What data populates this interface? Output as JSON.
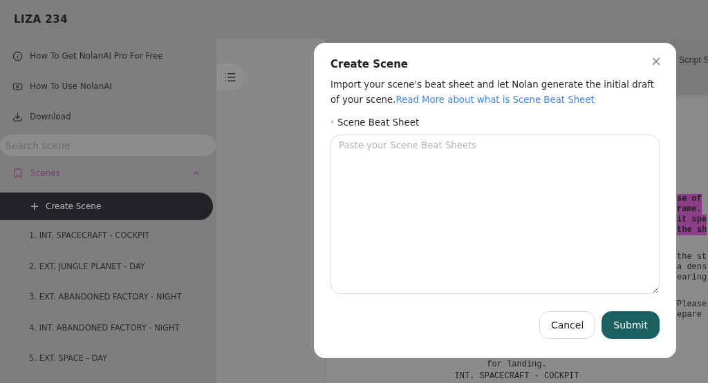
{
  "app": {
    "title": "LIZA 234"
  },
  "sidebar": {
    "links": [
      {
        "kind": "info",
        "label": "How To Get NolanAI Pro For Free"
      },
      {
        "kind": "video",
        "label": "How To Use NolanAI"
      },
      {
        "kind": "download",
        "label": "Download"
      }
    ],
    "search": {
      "placeholder": "Search scene"
    },
    "scenes": {
      "label": "Scenes",
      "expanded": true,
      "create_button": "Create Scene",
      "items": [
        "1. INT. SPACECRAFT - COCKPIT",
        "2. EXT. JUNGLE PLANET - DAY",
        "3. EXT. ABANDONED FACTORY - NIGHT",
        "4. INT. ABANDONED FACTORY - NIGHT",
        "5. EXT. SPACE - DAY"
      ]
    }
  },
  "editor": {
    "toolbar_text": "Script S",
    "blocks": [
      {
        "kind": "fragment",
        "highlighted": true,
        "lines": [
          "se of",
          "rame.",
          "it spe",
          "the sh"
        ]
      },
      {
        "kind": "fragment",
        "highlighted": false,
        "lines": [
          "the st",
          "a dens",
          "earing"
        ]
      },
      {
        "kind": "fragment",
        "highlighted": false,
        "lines": [
          "Please",
          "epare"
        ]
      },
      {
        "kind": "centered",
        "highlighted": false,
        "lines": [
          "for landing."
        ]
      },
      {
        "kind": "centered",
        "highlighted": false,
        "lines": [
          "INT. SPACECRAFT - COCKPIT"
        ]
      }
    ]
  },
  "modal": {
    "title": "Create Scene",
    "description": "Import your scene's beat sheet and let Nolan generate the initial draft of your scene.",
    "link": "Read More about what is Scene Beat Sheet",
    "field": {
      "required_mark": "*",
      "label": "Scene Beat Sheet",
      "placeholder": "Paste your Scene Beat Sheets"
    },
    "buttons": {
      "cancel": "Cancel",
      "submit": "Submit"
    }
  }
}
